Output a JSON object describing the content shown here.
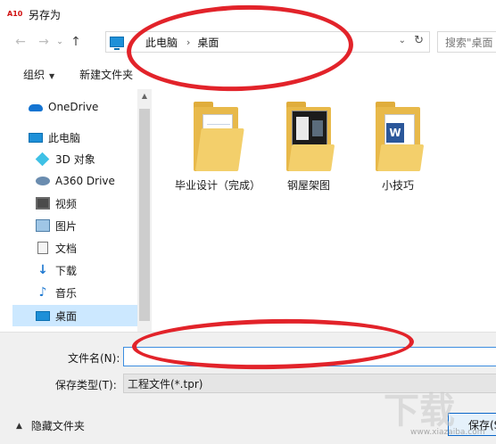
{
  "window": {
    "app_logo": "A10",
    "title": "另存为"
  },
  "navigation": {
    "back_icon": "←",
    "forward_icon": "→",
    "recent_icon": "⌄",
    "up_icon": "↑",
    "breadcrumbs": [
      "此电脑",
      "桌面"
    ],
    "breadcrumb_separator": "›",
    "dropdown_icon": "⌄",
    "refresh_icon": "↻",
    "search_placeholder": "搜索\"桌面"
  },
  "toolbar": {
    "organize_label": "组织",
    "organize_caret": "▼",
    "new_folder_label": "新建文件夹"
  },
  "sidebar": {
    "items": [
      {
        "label": "OneDrive",
        "icon": "onedrive-icon"
      },
      {
        "label": "此电脑",
        "icon": "pc-icon"
      },
      {
        "label": "3D 对象",
        "icon": "3d-objects-icon"
      },
      {
        "label": "A360 Drive",
        "icon": "a360-drive-icon"
      },
      {
        "label": "视频",
        "icon": "video-icon"
      },
      {
        "label": "图片",
        "icon": "pictures-icon"
      },
      {
        "label": "文档",
        "icon": "documents-icon"
      },
      {
        "label": "下载",
        "icon": "download-icon"
      },
      {
        "label": "音乐",
        "icon": "music-icon"
      },
      {
        "label": "桌面",
        "icon": "desktop-icon",
        "selected": true
      }
    ],
    "download_glyph": "↓",
    "music_glyph": "♪",
    "scroll_up_glyph": "▲"
  },
  "files": [
    {
      "label": "毕业设计（完成）",
      "type": "folder-documents"
    },
    {
      "label": "钢屋架图",
      "type": "folder-image"
    },
    {
      "label": "小技巧",
      "type": "folder-word"
    }
  ],
  "word_badge": "W",
  "form": {
    "filename_label": "文件名(N):",
    "filename_value": "",
    "filetype_label": "保存类型(T):",
    "filetype_value": "工程文件(*.tpr)",
    "hide_folders_caret": "▲",
    "hide_folders_label": "隐藏文件夹",
    "save_label": "保存(S)"
  },
  "colors": {
    "annotation_red": "#e2232a",
    "selection_blue": "#cce8ff",
    "accent_blue": "#3c8de0"
  }
}
